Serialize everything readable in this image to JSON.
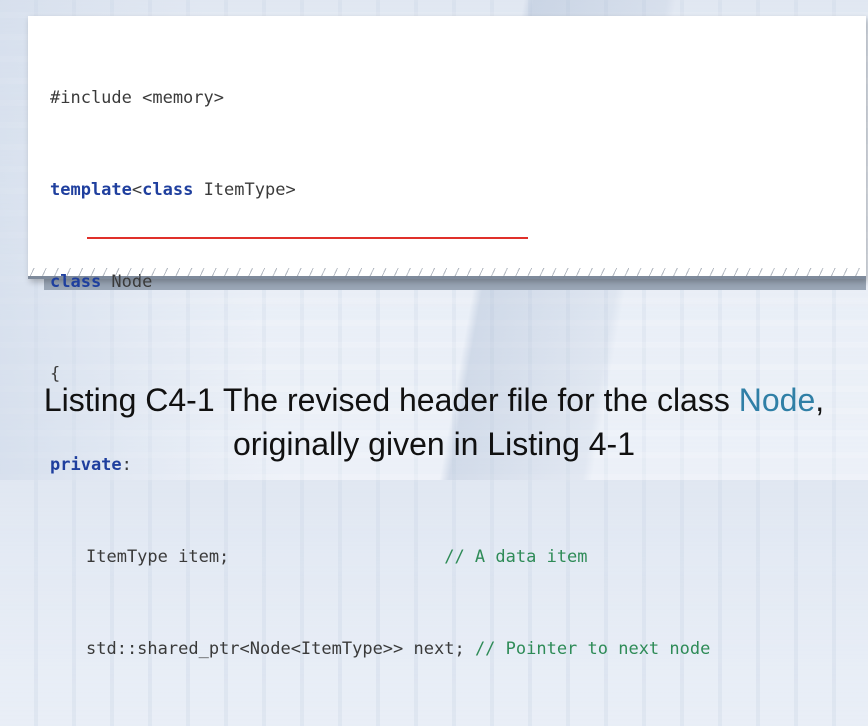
{
  "code_listing": {
    "lines": [
      {
        "segments": [
          {
            "text": "#include <memory>",
            "type": "plain"
          }
        ]
      },
      {
        "segments": [
          {
            "text": "template",
            "type": "keyword"
          },
          {
            "text": "<",
            "type": "plain"
          },
          {
            "text": "class",
            "type": "keyword"
          },
          {
            "text": " ItemType>",
            "type": "plain"
          }
        ]
      },
      {
        "segments": [
          {
            "text": "class",
            "type": "keyword"
          },
          {
            "text": " Node",
            "type": "plain"
          }
        ]
      },
      {
        "segments": [
          {
            "text": "{",
            "type": "plain"
          }
        ]
      },
      {
        "segments": [
          {
            "text": "private",
            "type": "keyword"
          },
          {
            "text": ":",
            "type": "plain"
          }
        ]
      },
      {
        "segments": [
          {
            "text": "ItemType item;",
            "type": "plain"
          },
          {
            "text": "                     // A data item",
            "type": "comment"
          }
        ]
      },
      {
        "segments": [
          {
            "text": "std::shared_ptr<Node<ItemType>> next;",
            "type": "plain"
          },
          {
            "text": " // Pointer to next node",
            "type": "comment"
          }
        ]
      }
    ]
  },
  "caption": {
    "line1_prefix": "Listing C4-1 The revised header file for the class ",
    "line1_highlight": "Node",
    "line1_suffix": ",",
    "line2": "originally given in Listing 4-1"
  },
  "colors": {
    "keyword": "#1f3f9e",
    "comment": "#2e8b57",
    "highlight": "#2f7fa6",
    "underline": "#e0302a"
  }
}
